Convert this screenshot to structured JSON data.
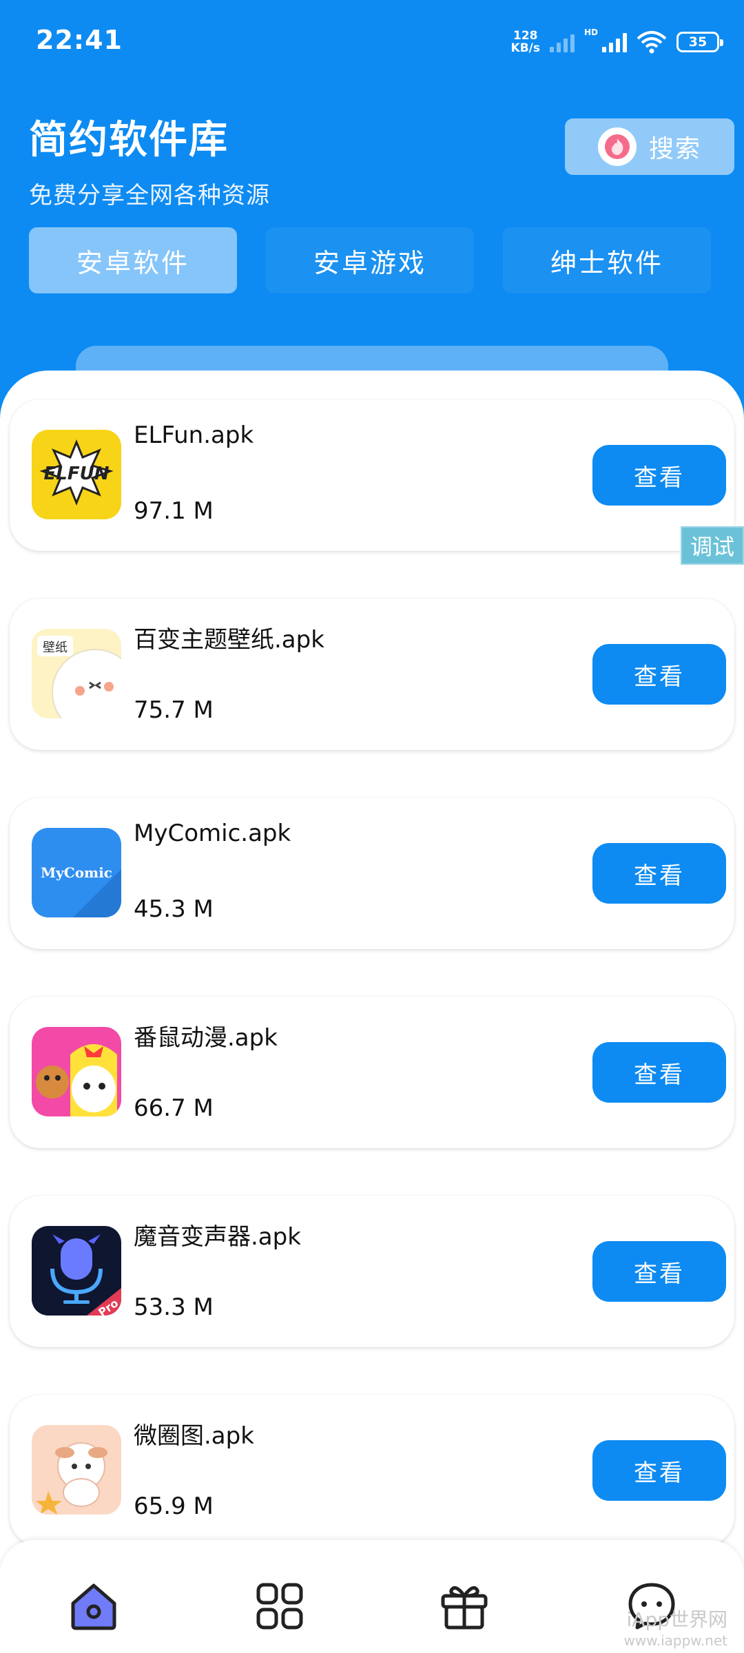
{
  "status_bar": {
    "time": "22:41",
    "net_speed_value": "128",
    "net_speed_unit": "KB/s",
    "hd_label": "HD",
    "battery": "35"
  },
  "header": {
    "title": "简约软件库",
    "subtitle": "免费分享全网各种资源",
    "search_label": "搜索"
  },
  "tabs": [
    {
      "label": "安卓软件",
      "active": true
    },
    {
      "label": "安卓游戏",
      "active": false
    },
    {
      "label": "绅士软件",
      "active": false
    }
  ],
  "apps": [
    {
      "name": "ELFun.apk",
      "size": "97.1 M",
      "button": "查看",
      "icon": "elfun-icon"
    },
    {
      "name": "百变主题壁纸.apk",
      "size": "75.7 M",
      "button": "查看",
      "icon": "wallpaper-icon",
      "icon_text": "壁纸"
    },
    {
      "name": "MyComic.apk",
      "size": "45.3 M",
      "button": "查看",
      "icon": "mycomic-icon",
      "icon_text": "MyComic"
    },
    {
      "name": "番鼠动漫.apk",
      "size": "66.7 M",
      "button": "查看",
      "icon": "anime-icon"
    },
    {
      "name": "魔音变声器.apk",
      "size": "53.3 M",
      "button": "查看",
      "icon": "voice-changer-icon",
      "icon_text": "Pro"
    },
    {
      "name": "微圈图.apk",
      "size": "65.9 M",
      "button": "查看",
      "icon": "weiquantu-icon"
    }
  ],
  "debug_badge": "调试",
  "bottom_nav": [
    {
      "icon": "home-icon",
      "active": true
    },
    {
      "icon": "grid-icon",
      "active": false
    },
    {
      "icon": "gift-icon",
      "active": false
    },
    {
      "icon": "chat-icon",
      "active": false
    }
  ],
  "watermark": {
    "line1": "iApp世界网",
    "line2": "www.iappw.net"
  },
  "colors": {
    "primary": "#0d8bf2",
    "accent": "#5fb1f7"
  }
}
